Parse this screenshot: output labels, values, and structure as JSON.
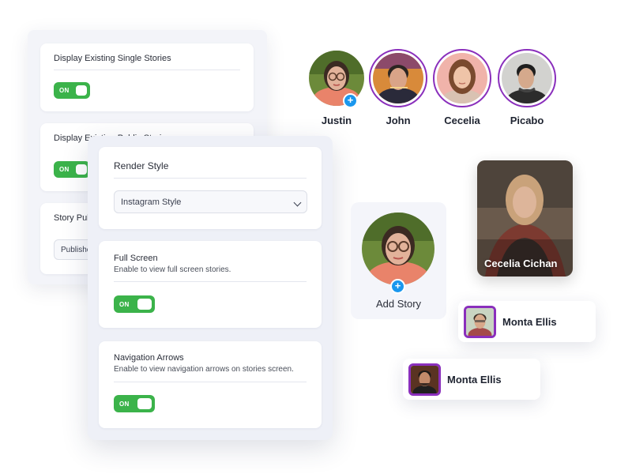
{
  "back_panel": {
    "card1": {
      "title": "Display Existing Single Stories",
      "toggle": "ON"
    },
    "card2": {
      "title": "Display Existing Public Stories",
      "toggle": "ON"
    },
    "card3": {
      "title": "Story Publish Status",
      "select_value": "Published"
    }
  },
  "front_panel": {
    "render_style": {
      "title": "Render Style",
      "select_value": "Instagram Style"
    },
    "full_screen": {
      "title": "Full Screen",
      "description": "Enable to view full screen stories.",
      "toggle": "ON"
    },
    "navigation_arrows": {
      "title": "Navigation Arrows",
      "description": "Enable to view navigation arrows on stories screen.",
      "toggle": "ON"
    }
  },
  "stories": [
    {
      "name": "Justin",
      "has_add": true
    },
    {
      "name": "John"
    },
    {
      "name": "Cecelia"
    },
    {
      "name": "Picabo"
    }
  ],
  "add_story": {
    "label": "Add Story",
    "plus": "+"
  },
  "featured_story": {
    "name": "Cecelia Cichan"
  },
  "chips": [
    {
      "name": "Monta Ellis"
    },
    {
      "name": "Monta Ellis"
    }
  ],
  "colors": {
    "toggle_on": "#3bb34a",
    "ring": "#8a2fbc",
    "add_badge": "#1a97ee",
    "panel_bg": "#eef0f7"
  }
}
